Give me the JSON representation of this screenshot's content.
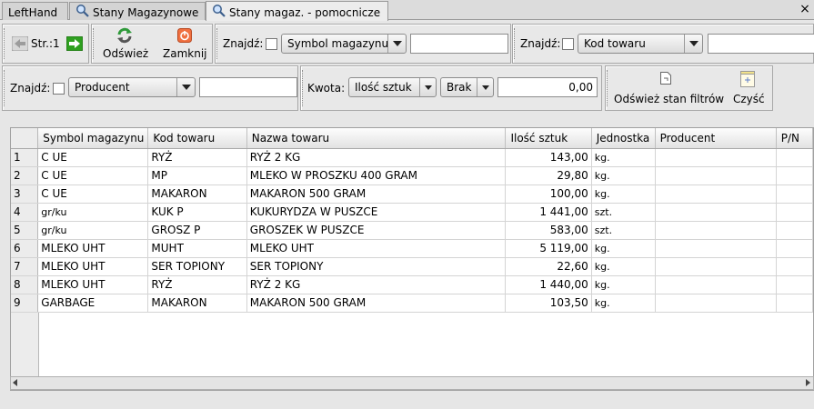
{
  "tabs": [
    {
      "label": "LeftHand",
      "icon": null
    },
    {
      "label": "Stany Magazynowe",
      "icon": "magnifier-icon"
    },
    {
      "label": "Stany magaz. - pomocnicze",
      "icon": "magnifier-icon"
    }
  ],
  "close_label": "×",
  "toolbar": {
    "page_label": "Str.:1",
    "refresh_label": "Odśwież",
    "close_label": "Zamknij",
    "refresh_filters_label": "Odśwież stan filtrów",
    "clear_label": "Czyść"
  },
  "filters": {
    "find1": {
      "label": "Znajdź:",
      "combo": "Symbol magazynu",
      "value": ""
    },
    "find2": {
      "label": "Znajdź:",
      "combo": "Kod towaru",
      "value": ""
    },
    "find3": {
      "label": "Znajdź:",
      "combo": "Producent",
      "value": ""
    },
    "amount": {
      "label": "Kwota:",
      "combo": "Ilość sztuk",
      "condition": "Brak",
      "value": "0,00"
    }
  },
  "table": {
    "columns": [
      "Symbol magazynu",
      "Kod towaru",
      "Nazwa towaru",
      "Ilość sztuk",
      "Jednostka",
      "Producent",
      "P/N"
    ],
    "rows": [
      {
        "n": "1",
        "symbol": "C UE",
        "kod": "RYŻ",
        "nazwa": "RYŻ 2 KG",
        "ilosc": "143,00",
        "jm": "kg.",
        "producent": "",
        "pn": ""
      },
      {
        "n": "2",
        "symbol": "C UE",
        "kod": "MP",
        "nazwa": "MLEKO W PROSZKU 400 GRAM",
        "ilosc": "29,80",
        "jm": "kg.",
        "producent": "",
        "pn": ""
      },
      {
        "n": "3",
        "symbol": "C UE",
        "kod": "MAKARON",
        "nazwa": "MAKARON 500 GRAM",
        "ilosc": "100,00",
        "jm": "kg.",
        "producent": "",
        "pn": ""
      },
      {
        "n": "4",
        "symbol": "gr/ku",
        "kod": "KUK P",
        "nazwa": "KUKURYDZA W PUSZCE",
        "ilosc": "1 441,00",
        "jm": "szt.",
        "producent": "",
        "pn": ""
      },
      {
        "n": "5",
        "symbol": "gr/ku",
        "kod": "GROSZ P",
        "nazwa": "GROSZEK W PUSZCE",
        "ilosc": "583,00",
        "jm": "szt.",
        "producent": "",
        "pn": ""
      },
      {
        "n": "6",
        "symbol": "MLEKO UHT",
        "kod": "MUHT",
        "nazwa": "MLEKO UHT",
        "ilosc": "5 119,00",
        "jm": "kg.",
        "producent": "",
        "pn": ""
      },
      {
        "n": "7",
        "symbol": "MLEKO UHT",
        "kod": "SER TOPIONY",
        "nazwa": "SER TOPIONY",
        "ilosc": "22,60",
        "jm": "kg.",
        "producent": "",
        "pn": ""
      },
      {
        "n": "8",
        "symbol": "MLEKO UHT",
        "kod": "RYŻ",
        "nazwa": "RYŻ 2 KG",
        "ilosc": "1 440,00",
        "jm": "kg.",
        "producent": "",
        "pn": ""
      },
      {
        "n": "9",
        "symbol": "GARBAGE",
        "kod": "MAKARON",
        "nazwa": "MAKARON 500 GRAM",
        "ilosc": "103,50",
        "jm": "kg.",
        "producent": "",
        "pn": ""
      }
    ]
  },
  "icons": {
    "prev": "arrow-left-icon",
    "next": "arrow-right-icon",
    "refresh": "refresh-icon",
    "close": "power-icon",
    "refresh_filters": "document-icon",
    "clear": "clear-icon"
  },
  "colors": {
    "next_arrow": "#2a9a1a",
    "close_icon": "#e8502a",
    "refresh_green": "#2f9a3a"
  }
}
